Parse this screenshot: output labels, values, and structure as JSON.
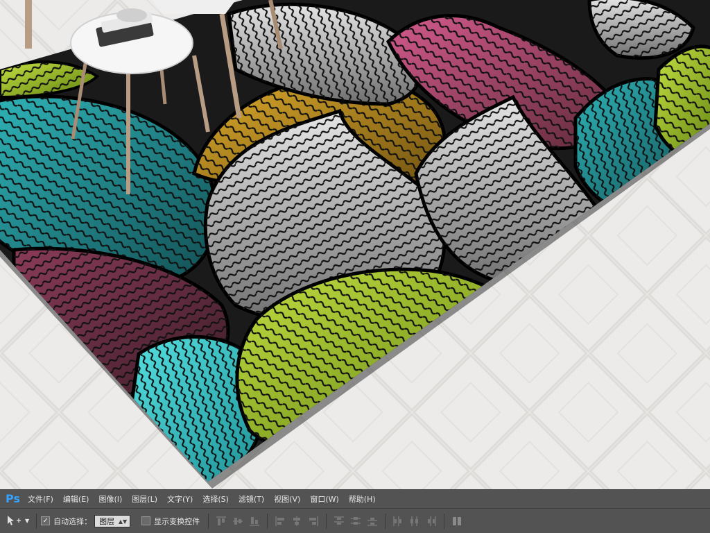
{
  "app": {
    "logo_text": "Ps",
    "accent": "#33a3ff"
  },
  "menubar": {
    "items": [
      {
        "label": "文件(F)"
      },
      {
        "label": "编辑(E)"
      },
      {
        "label": "图像(I)"
      },
      {
        "label": "图层(L)"
      },
      {
        "label": "文字(Y)"
      },
      {
        "label": "选择(S)"
      },
      {
        "label": "滤镜(T)"
      },
      {
        "label": "视图(V)"
      },
      {
        "label": "窗口(W)"
      },
      {
        "label": "帮助(H)"
      }
    ]
  },
  "options_bar": {
    "tool_icon": "move-tool-icon",
    "auto_select_label": "自动选择：",
    "auto_select_checked": true,
    "auto_select_target": "图层",
    "show_transform_label": "显示变换控件",
    "show_transform_checked": false
  },
  "scene": {
    "palette": {
      "teal": "#1d8a8e",
      "teal_light": "#39c6c9",
      "gray": "#9d9d9d",
      "gray_light": "#d9d9d9",
      "green": "#84a81e",
      "green_light": "#b6d434",
      "magenta": "#b94877",
      "plum": "#6b2c43",
      "ochre": "#c7971f",
      "floor": "#ecebea"
    }
  }
}
